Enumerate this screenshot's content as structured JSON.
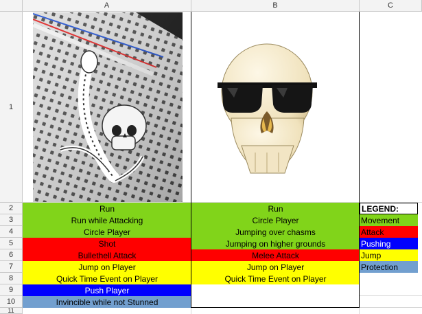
{
  "columns": [
    "A",
    "B",
    "C"
  ],
  "rows": [
    "1",
    "2",
    "3",
    "4",
    "5",
    "6",
    "7",
    "8",
    "9",
    "10",
    "11"
  ],
  "colors": {
    "movement": "#81d41a",
    "attack": "#ff0000",
    "pushing": "#0000ff",
    "jump": "#ffff00",
    "protection": "#729fcf"
  },
  "images": {
    "a1": "serpent-skull-on-breadboard-image",
    "b1": "skull-with-sunglasses-image"
  },
  "colA": [
    "Run",
    "Run while Attacking",
    "Circle Player",
    "Shot",
    "Bullethell Attack",
    "Jump on Player",
    "Quick Time Event on Player",
    "Push Player",
    "Invincible while not Stunned"
  ],
  "colB": [
    "Run",
    "Circle Player",
    "Jumping over chasms",
    "Jumping on higher grounds",
    "Melee Attack",
    "Jump on Player",
    "Quick Time Event on Player"
  ],
  "legend": {
    "title": "LEGEND:",
    "items": [
      "Movement",
      "Attack",
      "Pushing",
      "Jump",
      "Protection"
    ]
  }
}
